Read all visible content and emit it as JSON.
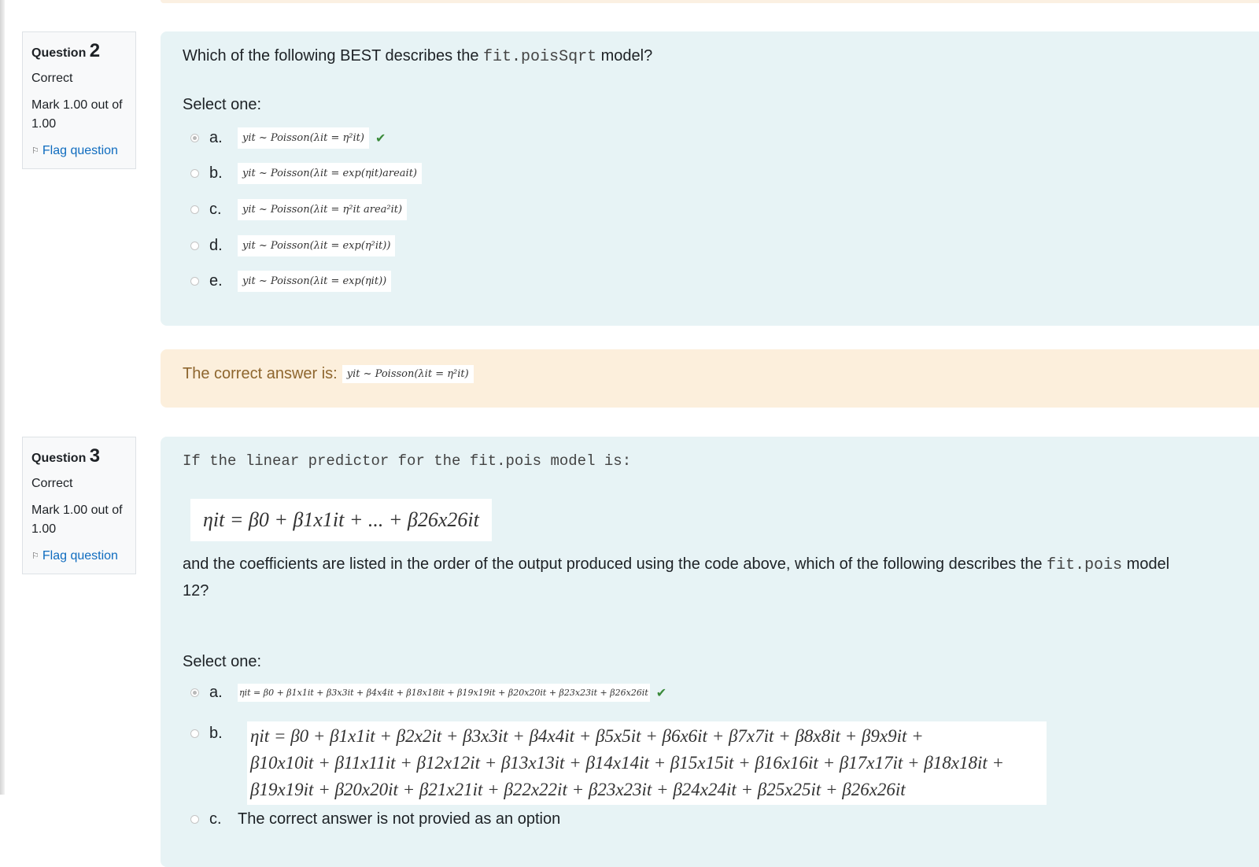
{
  "q2": {
    "label": "Question",
    "number": "2",
    "state": "Correct",
    "grade": "Mark 1.00 out of 1.00",
    "flag": "Flag question",
    "text_pre": "Which of the following BEST describes the ",
    "text_code": "fit.poisSqrt",
    "text_post": " model?",
    "select_one": "Select one:",
    "options": [
      {
        "letter": "a.",
        "math": "yit ~ Poisson(λit = η²it)",
        "selected": true,
        "correct": true
      },
      {
        "letter": "b.",
        "math": "yit ~ Poisson(λit = exp(ηit)areait)"
      },
      {
        "letter": "c.",
        "math": "yit ~ Poisson(λit = η²it area²it)"
      },
      {
        "letter": "d.",
        "math": "yit ~ Poisson(λit = exp(η²it))"
      },
      {
        "letter": "e.",
        "math": "yit ~ Poisson(λit = exp(ηit))"
      }
    ],
    "feedback_label": "The correct answer is:",
    "feedback_math": "yit ~ Poisson(λit = η²it)"
  },
  "q3": {
    "label": "Question",
    "number": "3",
    "state": "Correct",
    "grade": "Mark 1.00 out of 1.00",
    "flag": "Flag question",
    "intro_code": "If the linear predictor for the fit.pois model is:",
    "equation": "ηit = β0 + β1x1it + ... + β26x26it",
    "para_pre": "and the coefficients are listed in the order of the output produced using the code above, which of the following describes the ",
    "para_code": "fit.pois",
    "para_post": " model",
    "para_line2": "12?",
    "select_one": "Select one:",
    "options": [
      {
        "letter": "a.",
        "math": "ηit = β0 + β1x1it + β3x3it + β4x4it + β18x18it + β19x19it + β20x20it + β23x23it + β26x26it",
        "selected": true,
        "correct": true
      },
      {
        "letter": "b.",
        "math_lines": [
          "ηit = β0 + β1x1it + β2x2it + β3x3it + β4x4it + β5x5it + β6x6it + β7x7it + β8x8it + β9x9it +",
          "β10x10it + β11x11it + β12x12it + β13x13it + β14x14it + β15x15it + β16x16it + β17x17it + β18x18it +",
          "β19x19it + β20x20it + β21x21it + β22x22it + β23x23it + β24x24it + β25x25it + β26x26it"
        ]
      },
      {
        "letter": "c.",
        "text": "The correct answer is not provied as an option"
      }
    ]
  },
  "icons": {
    "check": "check-icon",
    "flag": "flag-icon"
  },
  "colors": {
    "formulation_bg": "#e7f3f5",
    "feedback_bg": "#fcefdc",
    "link": "#0f6cbf",
    "feedback_text": "#8e662e"
  }
}
